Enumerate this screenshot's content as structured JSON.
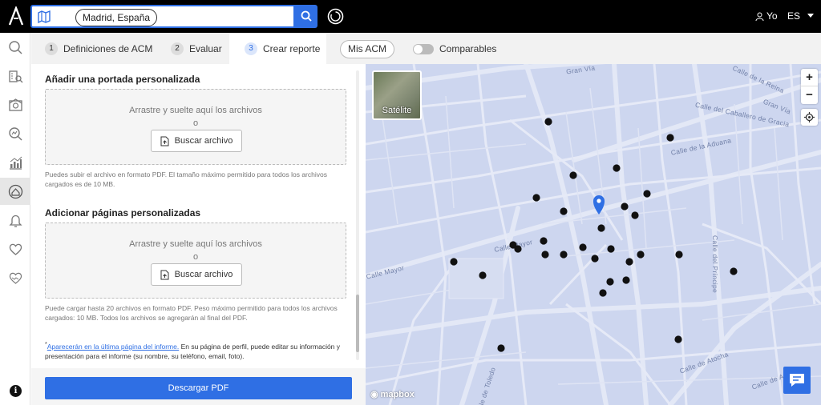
{
  "header": {
    "search_value": "Madrid, España",
    "user_label": "Yo",
    "lang_label": "ES"
  },
  "tabs": [
    {
      "num": "1",
      "label": "Definiciones de ACM"
    },
    {
      "num": "2",
      "label": "Evaluar"
    },
    {
      "num": "3",
      "label": "Crear reporte"
    }
  ],
  "mis_acm_label": "Mis ACM",
  "comparables_label": "Comparables",
  "cover": {
    "title": "Añadir una portada personalizada",
    "drop_text": "Arrastre y suelte aquí los archivos",
    "or_text": "o",
    "button_label": "Buscar archivo",
    "help": "Puedes subir el archivo en formato PDF. El tamaño máximo permitido para todos los archivos cargados es de 10 MB."
  },
  "pages": {
    "title": "Adicionar páginas personalizadas",
    "drop_text": "Arrastre y suelte aquí los archivos",
    "or_text": "o",
    "button_label": "Buscar archivo",
    "help": "Puede cargar hasta 20 archivos en formato PDF. Peso máximo permitido para todos los archivos cargados: 10 MB. Todos los archivos se agregarán al final del PDF."
  },
  "footnote": {
    "star": "*",
    "link": "Aparecerán en la última página del informe.",
    "rest": " En su página de perfil, puede editar su información y presentación para el informe (su nombre, su teléfono, email, foto)."
  },
  "download_label": "Descargar PDF",
  "map": {
    "satellite_label": "Satélite",
    "zoom_in": "+",
    "zoom_out": "−",
    "attribution": "mapbox",
    "streets": [
      "Gran Vía",
      "Calle de la Reina",
      "Gran Vía",
      "Calle del Caballero de Gracia",
      "Calle de la Aduana",
      "Calle Mayor",
      "Calle Mayor",
      "Calle del Príncipe",
      "Calle de Atocha",
      "Calle de Atocha",
      "Calle de Toledo"
    ],
    "marker_color": "#111111",
    "pin_color": "#2f6fe4"
  },
  "colors": {
    "accent": "#2f6fe4",
    "topbar": "#000000",
    "map_bg": "#cdd6ef"
  }
}
